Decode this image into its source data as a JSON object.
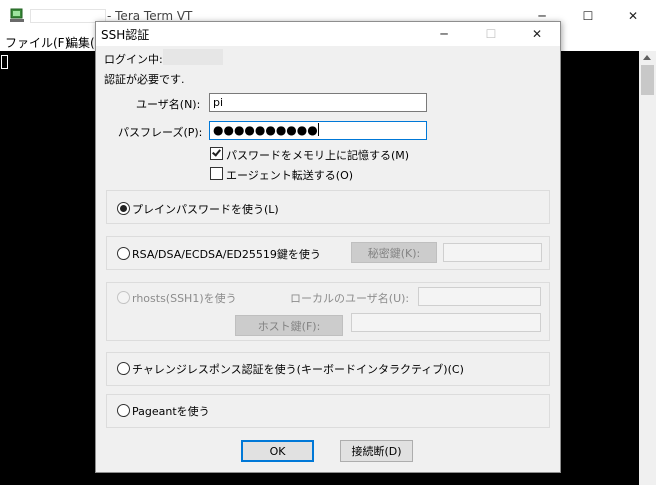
{
  "main_window": {
    "title": "- Tera Term VT",
    "menu": [
      "ファイル(F)",
      "編集("
    ],
    "controls": {
      "minimize": "─",
      "maximize": "☐",
      "close": "✕"
    }
  },
  "dialog": {
    "title": "SSH認証",
    "controls": {
      "minimize": "─",
      "maximize": "☐",
      "close": "✕"
    },
    "login_label": "ログイン中:",
    "auth_required": "認証が必要です.",
    "username_label": "ユーザ名(N):",
    "username_value": "pi",
    "passphrase_label": "パスフレーズ(P):",
    "passphrase_value": "●●●●●●●●●●",
    "remember_password_label": "パスワードをメモリ上に記憶する(M)",
    "remember_password_checked": true,
    "agent_forward_label": "エージェント転送する(O)",
    "agent_forward_checked": false,
    "method_plain": "プレインパスワードを使う(L)",
    "method_rsa": "RSA/DSA/ECDSA/ED25519鍵を使う",
    "private_key_button": "秘密鍵(K):",
    "method_rhosts": "rhosts(SSH1)を使う",
    "local_user_label": "ローカルのユーザ名(U):",
    "host_key_button": "ホスト鍵(F):",
    "method_challenge": "チャレンジレスポンス認証を使う(キーボードインタラクティブ)(C)",
    "method_pageant": "Pageantを使う",
    "selected_method": "plain",
    "ok_button": "OK",
    "disconnect_button": "接続断(D)"
  }
}
